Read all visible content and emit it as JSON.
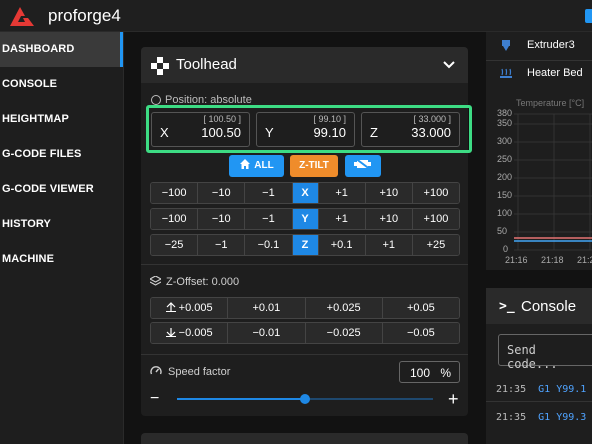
{
  "app": {
    "title": "proforge4",
    "brand_color": "#e53935",
    "accent": "#2196f3"
  },
  "sidebar": {
    "items": [
      {
        "label": "DASHBOARD",
        "active": true
      },
      {
        "label": "CONSOLE"
      },
      {
        "label": "HEIGHTMAP"
      },
      {
        "label": "G-CODE FILES"
      },
      {
        "label": "G-CODE VIEWER"
      },
      {
        "label": "HISTORY"
      },
      {
        "label": "MACHINE"
      }
    ]
  },
  "toolhead": {
    "title": "Toolhead",
    "position_label": "Position: absolute",
    "positions": [
      {
        "axis": "X",
        "value": "100.50",
        "requested": "[ 100.50 ]"
      },
      {
        "axis": "Y",
        "value": "99.10",
        "requested": "[ 99.10 ]"
      },
      {
        "axis": "Z",
        "value": "33.000",
        "requested": "[ 33.000 ]"
      }
    ],
    "home_all_label": "ALL",
    "ztilt_label": "Z-TILT",
    "jog_x": [
      "−100",
      "−10",
      "−1",
      "X",
      "+1",
      "+10",
      "+100"
    ],
    "jog_y": [
      "−100",
      "−10",
      "−1",
      "Y",
      "+1",
      "+10",
      "+100"
    ],
    "jog_z": [
      "−25",
      "−1",
      "−0.1",
      "Z",
      "+0.1",
      "+1",
      "+25"
    ],
    "zoffset_label": "Z-Offset: 0.000",
    "zoffset_up": [
      "+0.005",
      "+0.01",
      "+0.025",
      "+0.05"
    ],
    "zoffset_down": [
      "−0.005",
      "−0.01",
      "−0.025",
      "−0.05"
    ],
    "speed_label": "Speed factor",
    "speed_value": "100",
    "speed_unit": "%",
    "speed_fraction": 0.5,
    "minus": "−",
    "plus": "+"
  },
  "temperatures": {
    "rows": [
      {
        "label": "Extruder3"
      },
      {
        "label": "Heater Bed"
      }
    ],
    "chart_title": "Temperature [°C]",
    "y_ticks": [
      "380",
      "350",
      "300",
      "250",
      "200",
      "150",
      "100",
      "50",
      "0"
    ],
    "x_ticks": [
      "21:16",
      "21:18",
      "21:2"
    ]
  },
  "console": {
    "title": "Console",
    "icon": ">_",
    "input_placeholder": "Send code...",
    "lines": [
      {
        "time": "21:35",
        "cmd": "G1 Y99.1 F"
      },
      {
        "time": "21:35",
        "cmd": "G1 Y99.3 F"
      }
    ]
  }
}
